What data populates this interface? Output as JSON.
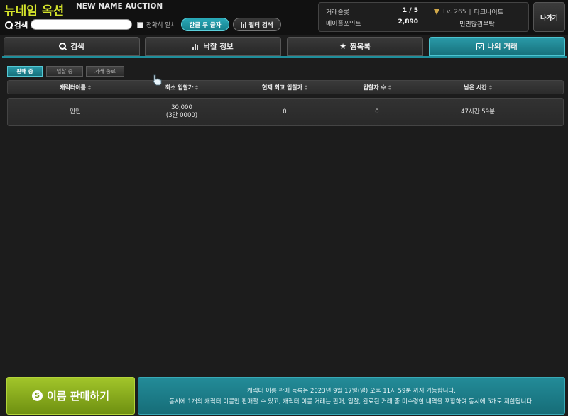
{
  "header": {
    "brand": "뉴네임 옥션",
    "brand_sub": "NEW NAME AUCTION",
    "search_label": "검색",
    "search_value": "",
    "exact_match_label": "정확히 일치",
    "hangul_btn": "한글 두 글자",
    "filter_btn": "필터 검색",
    "exit_btn": "나가기"
  },
  "info": {
    "slots_label": "거래슬롯",
    "slots_value": "1 / 5",
    "points_label": "메이플포인트",
    "points_value": "2,890",
    "level": "Lv. 265",
    "job": "다크나이트",
    "guild": "민민많관부탁"
  },
  "tabs": [
    {
      "label": "검색",
      "icon": "search-icon"
    },
    {
      "label": "낙찰 정보",
      "icon": "bar-chart-icon"
    },
    {
      "label": "찜목록",
      "icon": "star-icon"
    },
    {
      "label": "나의 거래",
      "icon": "check-icon",
      "active": true
    }
  ],
  "subtabs": [
    {
      "label": "판매 중",
      "active": true
    },
    {
      "label": "입찰 중"
    },
    {
      "label": "거래 종료"
    }
  ],
  "table": {
    "headers": [
      "캐릭터이름",
      "최소 입찰가",
      "현재 최고 입찰가",
      "입찰자 수",
      "남은 시간"
    ],
    "rows": [
      {
        "name": "민민",
        "min_bid": "30,000",
        "min_bid_sub": "(3만 0000)",
        "top_bid": "0",
        "bidders": "0",
        "remaining": "47시간 59분"
      }
    ]
  },
  "bottom": {
    "sell_btn": "이름 판매하기",
    "notice_line1": "캐릭터 이름 판매 등록은 2023년 9월 17일(일) 오후 11시 59분 까지 가능합니다.",
    "notice_line2": "동시에 1개의 캐릭터 이름만 판매할 수 있고, 캐릭터 이름 거래는 판매, 입찰, 완료된 거래 중 미수령한 내역을 포함하여 동시에 5개로 제한됩니다."
  },
  "colors": {
    "brand": "#d4e32b",
    "accent": "#1f8f9c",
    "sell_green": "#8db31f"
  }
}
